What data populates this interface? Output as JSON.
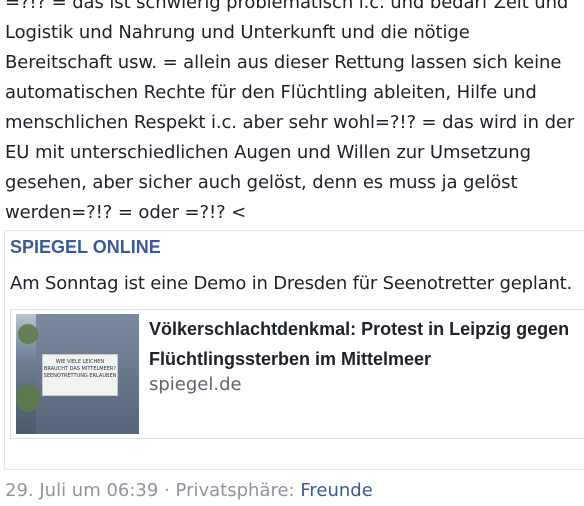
{
  "post": {
    "lines": [
      "=?!? = das ist schwierig problematisch i.c. und bedarf Zeit und",
      "Logistik und Nahrung und Unterkunft und die nötige",
      "Bereitschaft usw. = allein aus dieser Rettung lassen sich keine",
      "automatischen Rechte für den Flüchtling ableiten, Hilfe und",
      "menschlichen Respekt i.c. aber sehr wohl=?!? = das wird in der",
      "EU mit unterschiedlichen Augen und Willen zur Umsetzung",
      "gesehen, aber sicher auch gelöst, denn es muss ja gelöst",
      "werden=?!? = oder =?!? <"
    ]
  },
  "shared": {
    "source": "SPIEGEL ONLINE",
    "message": "Am Sonntag ist eine Demo in Dresden für Seenotretter geplant.",
    "link": {
      "title": "Völkerschlachtdenkmal: Protest in Leipzig gegen Flüchtlingssterben im Mittelmeer",
      "domain": "spiegel.de",
      "thumb_banner_lines": [
        "WIE VIELE LEICHEN",
        "BRAUCHT DAS MITTELMEER?",
        "SEENOTRETTUNG ERLAUBEN"
      ]
    }
  },
  "meta": {
    "timestamp": "29. Juli um 06:39",
    "separator": "·",
    "privacy_label": "Privatsphäre:",
    "audience": "Freunde"
  },
  "colors": {
    "link_blue": "#3b5998",
    "muted_gray": "#90949c"
  }
}
